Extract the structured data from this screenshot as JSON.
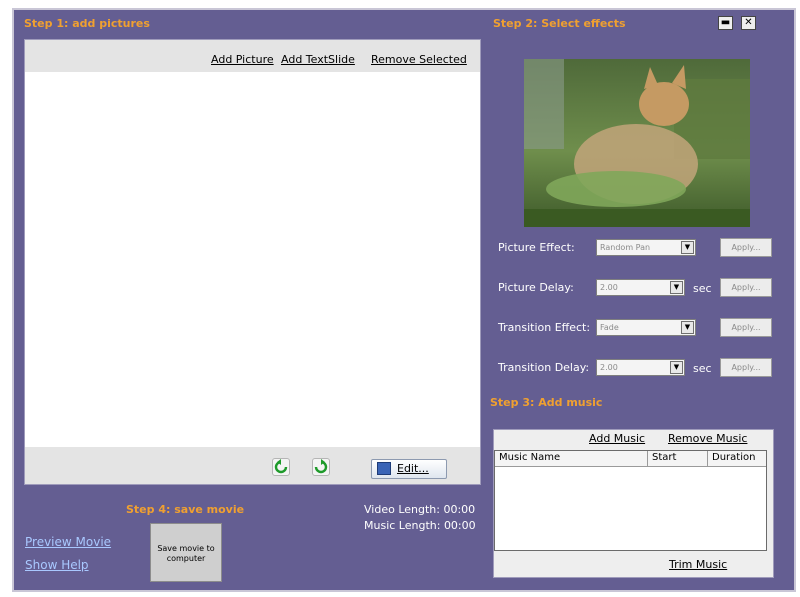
{
  "window": {
    "minimize_icon": "minimize-icon",
    "close_icon": "close-icon"
  },
  "step1": {
    "title": "Step 1: add pictures",
    "add_picture": "Add Picture",
    "add_textslide": "Add TextSlide",
    "remove_selected": "Remove Selected",
    "rotate_left_icon": "rotate-left-icon",
    "rotate_right_icon": "rotate-right-icon",
    "edit_label": "Edit..."
  },
  "step2": {
    "title": "Step 2: Select effects",
    "preview_subject": "kitten-preview-image",
    "rows": [
      {
        "label": "Picture Effect:",
        "value": "Random Pan",
        "unit": "",
        "apply": "Apply..."
      },
      {
        "label": "Picture Delay:",
        "value": "2.00",
        "unit": "sec",
        "apply": "Apply..."
      },
      {
        "label": "Transition Effect:",
        "value": "Fade",
        "unit": "",
        "apply": "Apply..."
      },
      {
        "label": "Transition Delay:",
        "value": "2.00",
        "unit": "sec",
        "apply": "Apply..."
      }
    ]
  },
  "step3": {
    "title": "Step 3: Add music",
    "add_music": "Add Music",
    "remove_music": "Remove Music",
    "columns": [
      "Music Name",
      "Start",
      "Duration"
    ],
    "trim_music": "Trim Music"
  },
  "step4": {
    "title": "Step 4: save movie",
    "save_button": "Save movie to computer",
    "video_length": "Video Length: 00:00",
    "music_length": "Music Length: 00:00",
    "preview_movie": "Preview Movie",
    "show_help": "Show Help"
  },
  "colors": {
    "background": "#645e92",
    "step_title": "#f0a030",
    "link": "#a9c8ff"
  }
}
